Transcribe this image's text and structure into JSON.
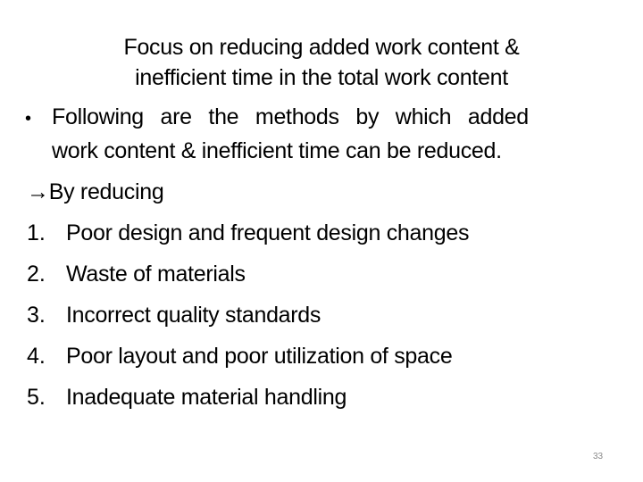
{
  "slide": {
    "title_lines": [
      "Focus on reducing added work content &",
      "inefficient time in the total work content"
    ],
    "bullet": {
      "lines": [
        "Following are the methods by which added",
        "work content  & inefficient time can be reduced."
      ]
    },
    "arrow_line": "→By reducing",
    "items": [
      {
        "num": "1.",
        "text": "Poor design and frequent design changes"
      },
      {
        "num": "2.",
        "text": "Waste of materials"
      },
      {
        "num": "3.",
        "text": "Incorrect quality standards"
      },
      {
        "num": "4.",
        "text": "Poor layout and poor utilization of space"
      },
      {
        "num": "5.",
        "text": "Inadequate material handling"
      }
    ],
    "page_number": "33"
  }
}
